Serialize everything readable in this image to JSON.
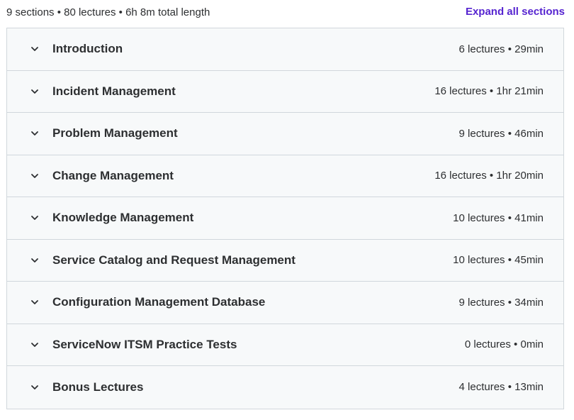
{
  "summary": {
    "text": "9 sections • 80 lectures • 6h 8m total length",
    "expand_label": "Expand all sections"
  },
  "icons": {
    "section_toggle": "chevron-down-icon"
  },
  "colors": {
    "accent": "#5624d0",
    "row_bg": "#f7f9fa",
    "border": "#d1d7dc",
    "text": "#2d2f31"
  },
  "sections": [
    {
      "title": "Introduction",
      "meta": "6 lectures • 29min"
    },
    {
      "title": "Incident Management",
      "meta": "16 lectures • 1hr 21min"
    },
    {
      "title": "Problem Management",
      "meta": "9 lectures • 46min"
    },
    {
      "title": "Change Management",
      "meta": "16 lectures • 1hr 20min"
    },
    {
      "title": "Knowledge Management",
      "meta": "10 lectures • 41min"
    },
    {
      "title": "Service Catalog and Request Management",
      "meta": "10 lectures • 45min"
    },
    {
      "title": "Configuration Management Database",
      "meta": "9 lectures • 34min"
    },
    {
      "title": "ServiceNow ITSM Practice Tests",
      "meta": "0 lectures • 0min"
    },
    {
      "title": "Bonus Lectures",
      "meta": "4 lectures • 13min"
    }
  ]
}
